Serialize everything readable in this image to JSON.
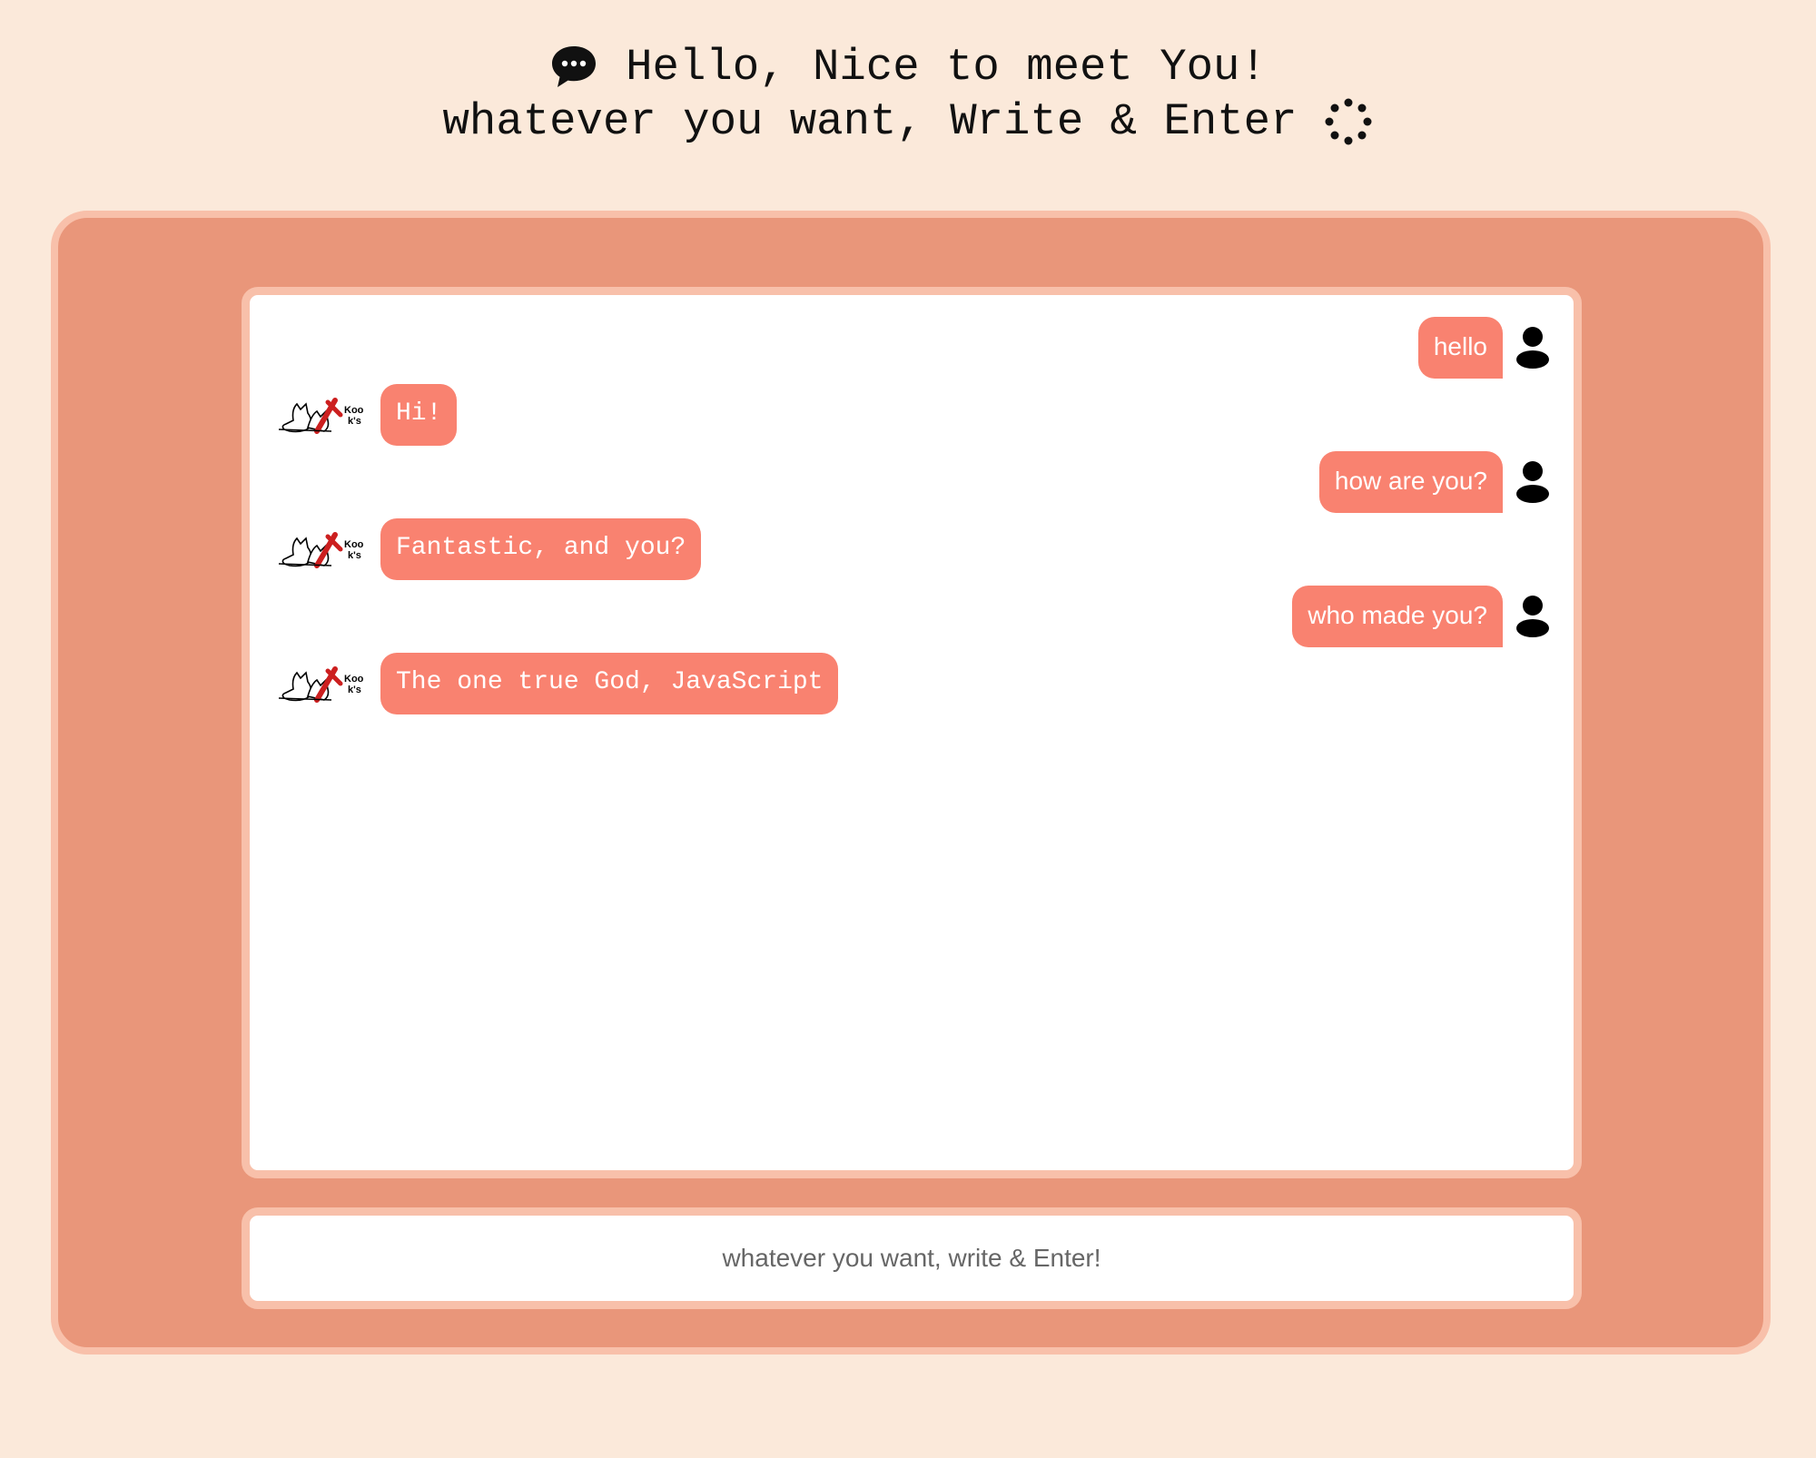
{
  "header": {
    "line1": "Hello, Nice to meet You!",
    "line2": "whatever you want, Write & Enter",
    "line1_icon": "speech-bubble-icon",
    "line2_icon": "loading-dots-icon"
  },
  "colors": {
    "background": "#fbe9da",
    "panel": "#e9967a",
    "panel_border": "#f8c0aa",
    "bubble": "#f98270"
  },
  "messages": [
    {
      "sender": "user",
      "text": "hello",
      "avatar": "user-icon"
    },
    {
      "sender": "bot",
      "text": "Hi!",
      "avatar": "cat-kooks-logo"
    },
    {
      "sender": "user",
      "text": "how are you?",
      "avatar": "user-icon"
    },
    {
      "sender": "bot",
      "text": "Fantastic, and you?",
      "avatar": "cat-kooks-logo"
    },
    {
      "sender": "user",
      "text": "who made you?",
      "avatar": "user-icon"
    },
    {
      "sender": "bot",
      "text": "The one true God, JavaScript",
      "avatar": "cat-kooks-logo"
    }
  ],
  "input": {
    "placeholder": "whatever you want, write & Enter!",
    "value": ""
  },
  "bot_logo_text": "Kooks"
}
